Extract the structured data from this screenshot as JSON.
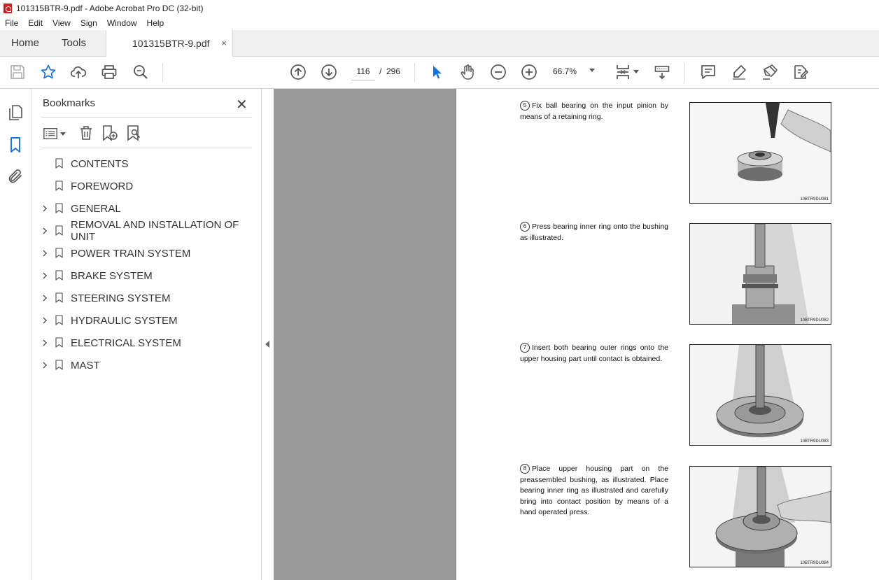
{
  "window": {
    "title": "101315BTR-9.pdf - Adobe Acrobat Pro DC (32-bit)"
  },
  "menu": [
    "File",
    "Edit",
    "View",
    "Sign",
    "Window",
    "Help"
  ],
  "tabs": {
    "home": "Home",
    "tools": "Tools",
    "document": "101315BTR-9.pdf",
    "close": "×"
  },
  "toolbar": {
    "page_current": "116",
    "page_separator": "/",
    "page_total": "296",
    "zoom": "66.7%"
  },
  "bookmarks": {
    "title": "Bookmarks",
    "close": "✕",
    "items": [
      {
        "label": "CONTENTS",
        "expandable": false
      },
      {
        "label": "FOREWORD",
        "expandable": false
      },
      {
        "label": "GENERAL",
        "expandable": true
      },
      {
        "label": "REMOVAL AND INSTALLATION OF UNIT",
        "expandable": true
      },
      {
        "label": "POWER TRAIN SYSTEM",
        "expandable": true
      },
      {
        "label": "BRAKE SYSTEM",
        "expandable": true
      },
      {
        "label": "STEERING SYSTEM",
        "expandable": true
      },
      {
        "label": "HYDRAULIC SYSTEM",
        "expandable": true
      },
      {
        "label": "ELECTRICAL SYSTEM",
        "expandable": true
      },
      {
        "label": "MAST",
        "expandable": true
      }
    ]
  },
  "document": {
    "steps": [
      {
        "num": "5",
        "text": "Fix ball bearing on the input pinion by means of a retaining ring.",
        "image_code": "10BTR9DU081"
      },
      {
        "num": "6",
        "text": "Press bearing inner ring onto the bushing as illustrated.",
        "image_code": "10BTR9DU082"
      },
      {
        "num": "7",
        "text": "Insert both bearing outer rings onto the upper housing part until contact is obtained.",
        "image_code": "10BTR9DU083"
      },
      {
        "num": "8",
        "text": "Place upper housing part on the preassembled bushing, as illustrated. Place bearing inner ring as illustrated and carefully bring into contact position by means of a hand operated press.",
        "image_code": "10BTR9DU084"
      }
    ]
  },
  "colors": {
    "accent": "#1473e6",
    "canvas": "#9a9a9a"
  }
}
